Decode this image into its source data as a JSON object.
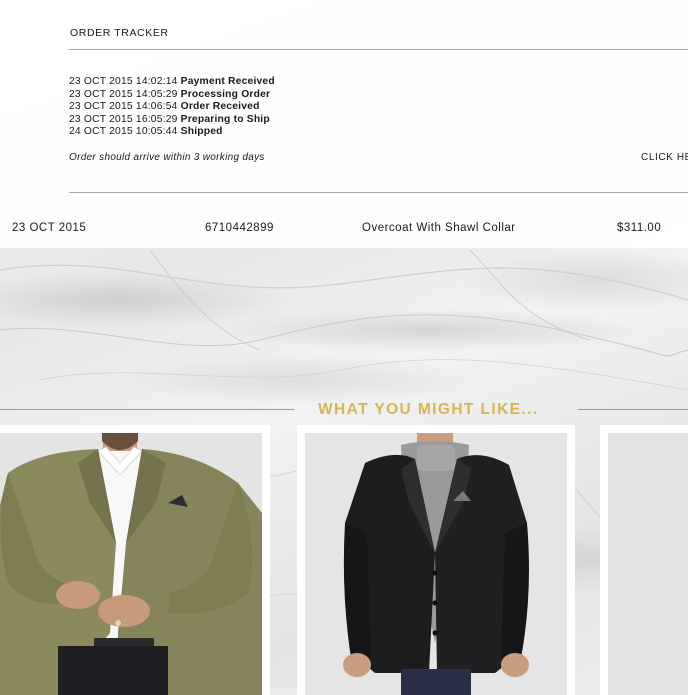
{
  "tracker": {
    "title": "ORDER TRACKER",
    "events": [
      {
        "timestamp": "23 OCT 2015 14:02:14",
        "status": "Payment Received"
      },
      {
        "timestamp": "23 OCT 2015 14:05:29",
        "status": "Processing Order"
      },
      {
        "timestamp": "23 OCT 2015 14:06:54",
        "status": "Order Received"
      },
      {
        "timestamp": "23 OCT 2015 16:05:29",
        "status": "Preparing to Ship"
      },
      {
        "timestamp": "24 OCT 2015 10:05:44",
        "status": "Shipped"
      }
    ],
    "arrival_note": "Order should arrive within 3 working days",
    "click_here": "CLICK HE"
  },
  "order": {
    "date": "23 OCT 2015",
    "number": "6710442899",
    "item": "Overcoat With Shawl Collar",
    "price": "$311.00"
  },
  "recommendations": {
    "heading": "WHAT YOU MIGHT LIKE...",
    "heading_color": "#d8b453",
    "products": [
      {
        "image": "olive-blazer-photo"
      },
      {
        "image": "black-blazer-photo"
      },
      {
        "image": "product-photo-partial"
      }
    ]
  }
}
